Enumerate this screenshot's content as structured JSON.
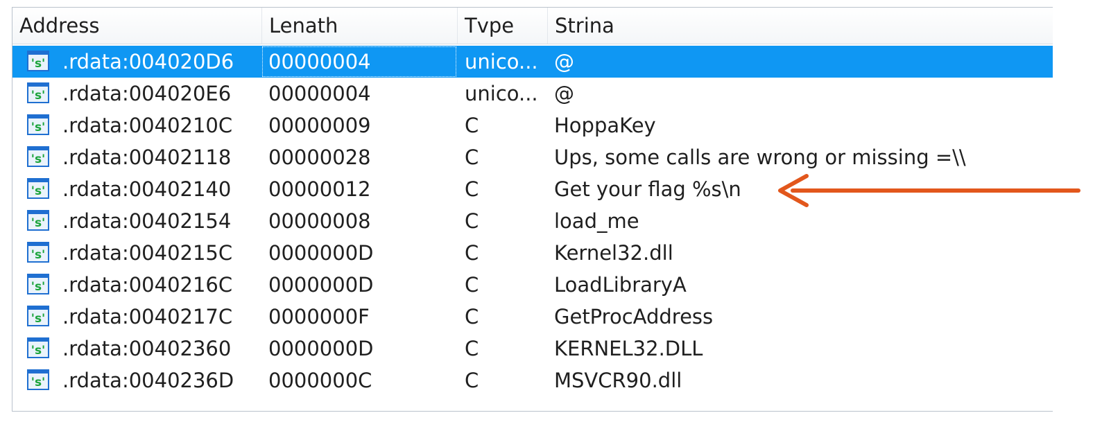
{
  "columns": {
    "address": "Address",
    "length": "Lenath",
    "type": "Tvpe",
    "string": "Strina"
  },
  "rows": [
    {
      "address": ".rdata:004020D6",
      "length": "00000004",
      "type": "unico...",
      "string": "@",
      "selected": true
    },
    {
      "address": ".rdata:004020E6",
      "length": "00000004",
      "type": "unico...",
      "string": "@"
    },
    {
      "address": ".rdata:0040210C",
      "length": "00000009",
      "type": "C",
      "string": "HoppaKey"
    },
    {
      "address": ".rdata:00402118",
      "length": "00000028",
      "type": "C",
      "string": "Ups, some calls are wrong or missing =\\\\"
    },
    {
      "address": ".rdata:00402140",
      "length": "00000012",
      "type": "C",
      "string": "Get your flag %s\\n"
    },
    {
      "address": ".rdata:00402154",
      "length": "00000008",
      "type": "C",
      "string": "load_me"
    },
    {
      "address": ".rdata:0040215C",
      "length": "0000000D",
      "type": "C",
      "string": "Kernel32.dll"
    },
    {
      "address": ".rdata:0040216C",
      "length": "0000000D",
      "type": "C",
      "string": "LoadLibraryA"
    },
    {
      "address": ".rdata:0040217C",
      "length": "0000000F",
      "type": "C",
      "string": "GetProcAddress"
    },
    {
      "address": ".rdata:00402360",
      "length": "0000000D",
      "type": "C",
      "string": "KERNEL32.DLL"
    },
    {
      "address": ".rdata:0040236D",
      "length": "0000000C",
      "type": "C",
      "string": "MSVCR90.dll"
    }
  ],
  "icons": {
    "row_icon": "string-literal-icon",
    "annotation": "arrow-left-icon"
  },
  "colors": {
    "selection": "#0f97f3",
    "arrow": "#e2571c",
    "icon_green": "#1aa33a",
    "icon_blue": "#1f6fd1"
  }
}
